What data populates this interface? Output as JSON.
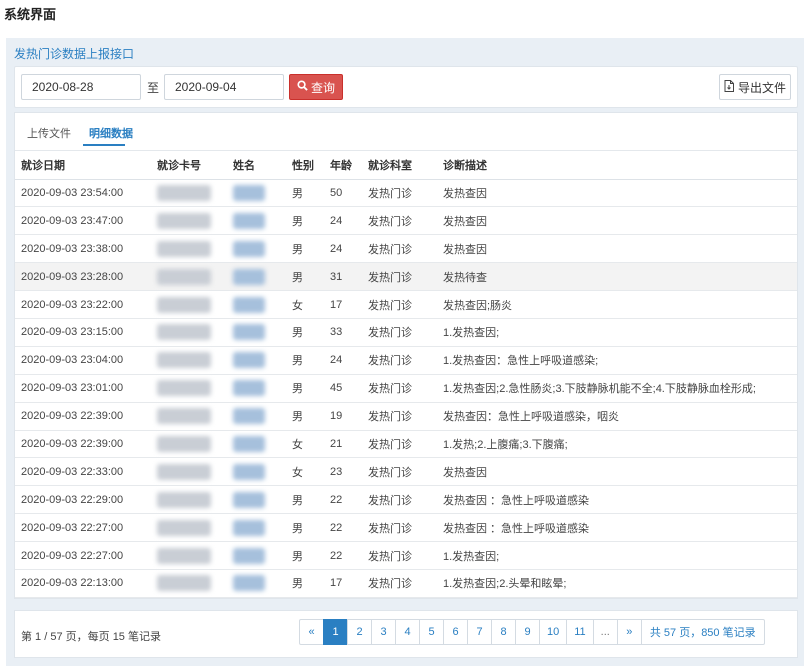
{
  "page": {
    "heading": "系统界面"
  },
  "panel": {
    "title": "发热门诊数据上报接口"
  },
  "toolbar": {
    "date_from": "2020-08-28",
    "separator": "至",
    "date_to": "2020-09-04",
    "query_label": "查询",
    "export_label": "导出文件"
  },
  "tabs": [
    {
      "label": "上传文件",
      "active": false
    },
    {
      "label": "明细数据",
      "active": true
    }
  ],
  "table": {
    "columns": [
      "就诊日期",
      "就诊卡号",
      "姓名",
      "性别",
      "年龄",
      "就诊科室",
      "诊断描述"
    ],
    "rows": [
      {
        "date": "2020-09-03 23:54:00",
        "sex": "男",
        "age": "50",
        "dept": "发热门诊",
        "diagnosis": "发热查因"
      },
      {
        "date": "2020-09-03 23:47:00",
        "sex": "男",
        "age": "24",
        "dept": "发热门诊",
        "diagnosis": "发热查因"
      },
      {
        "date": "2020-09-03 23:38:00",
        "sex": "男",
        "age": "24",
        "dept": "发热门诊",
        "diagnosis": "发热查因"
      },
      {
        "date": "2020-09-03 23:28:00",
        "sex": "男",
        "age": "31",
        "dept": "发热门诊",
        "diagnosis": "发热待查"
      },
      {
        "date": "2020-09-03 23:22:00",
        "sex": "女",
        "age": "17",
        "dept": "发热门诊",
        "diagnosis": "发热查因;肠炎"
      },
      {
        "date": "2020-09-03 23:15:00",
        "sex": "男",
        "age": "33",
        "dept": "发热门诊",
        "diagnosis": "1.发热查因;"
      },
      {
        "date": "2020-09-03 23:04:00",
        "sex": "男",
        "age": "24",
        "dept": "发热门诊",
        "diagnosis": "1.发热查因：急性上呼吸道感染;"
      },
      {
        "date": "2020-09-03 23:01:00",
        "sex": "男",
        "age": "45",
        "dept": "发热门诊",
        "diagnosis": "1.发热查因;2.急性肠炎;3.下肢静脉机能不全;4.下肢静脉血栓形成;"
      },
      {
        "date": "2020-09-03 22:39:00",
        "sex": "男",
        "age": "19",
        "dept": "发热门诊",
        "diagnosis": "发热查因：急性上呼吸道感染，咽炎"
      },
      {
        "date": "2020-09-03 22:39:00",
        "sex": "女",
        "age": "21",
        "dept": "发热门诊",
        "diagnosis": "1.发热;2.上腹痛;3.下腹痛;"
      },
      {
        "date": "2020-09-03 22:33:00",
        "sex": "女",
        "age": "23",
        "dept": "发热门诊",
        "diagnosis": "发热查因"
      },
      {
        "date": "2020-09-03 22:29:00",
        "sex": "男",
        "age": "22",
        "dept": "发热门诊",
        "diagnosis": "发热查因 ：急性上呼吸道感染"
      },
      {
        "date": "2020-09-03 22:27:00",
        "sex": "男",
        "age": "22",
        "dept": "发热门诊",
        "diagnosis": "发热查因 ：急性上呼吸道感染"
      },
      {
        "date": "2020-09-03 22:27:00",
        "sex": "男",
        "age": "22",
        "dept": "发热门诊",
        "diagnosis": "1.发热查因;"
      },
      {
        "date": "2020-09-03 22:13:00",
        "sex": "男",
        "age": "17",
        "dept": "发热门诊",
        "diagnosis": "1.发热查因;2.头晕和眩晕;"
      }
    ],
    "highlighted_row": 3
  },
  "footer": {
    "info": "第 1 / 57 页，每页 15 笔记录",
    "pages": [
      "«",
      "1",
      "2",
      "3",
      "4",
      "5",
      "6",
      "7",
      "8",
      "9",
      "10",
      "11",
      "...",
      "»"
    ],
    "current_page": "1",
    "summary": "共 57 页，850 笔记录"
  },
  "colors": {
    "accent": "#2a7fc2",
    "danger": "#d9534f",
    "panel_bg": "#e9eff5"
  },
  "icons": {
    "query": "search-icon",
    "export": "file-export-icon"
  }
}
